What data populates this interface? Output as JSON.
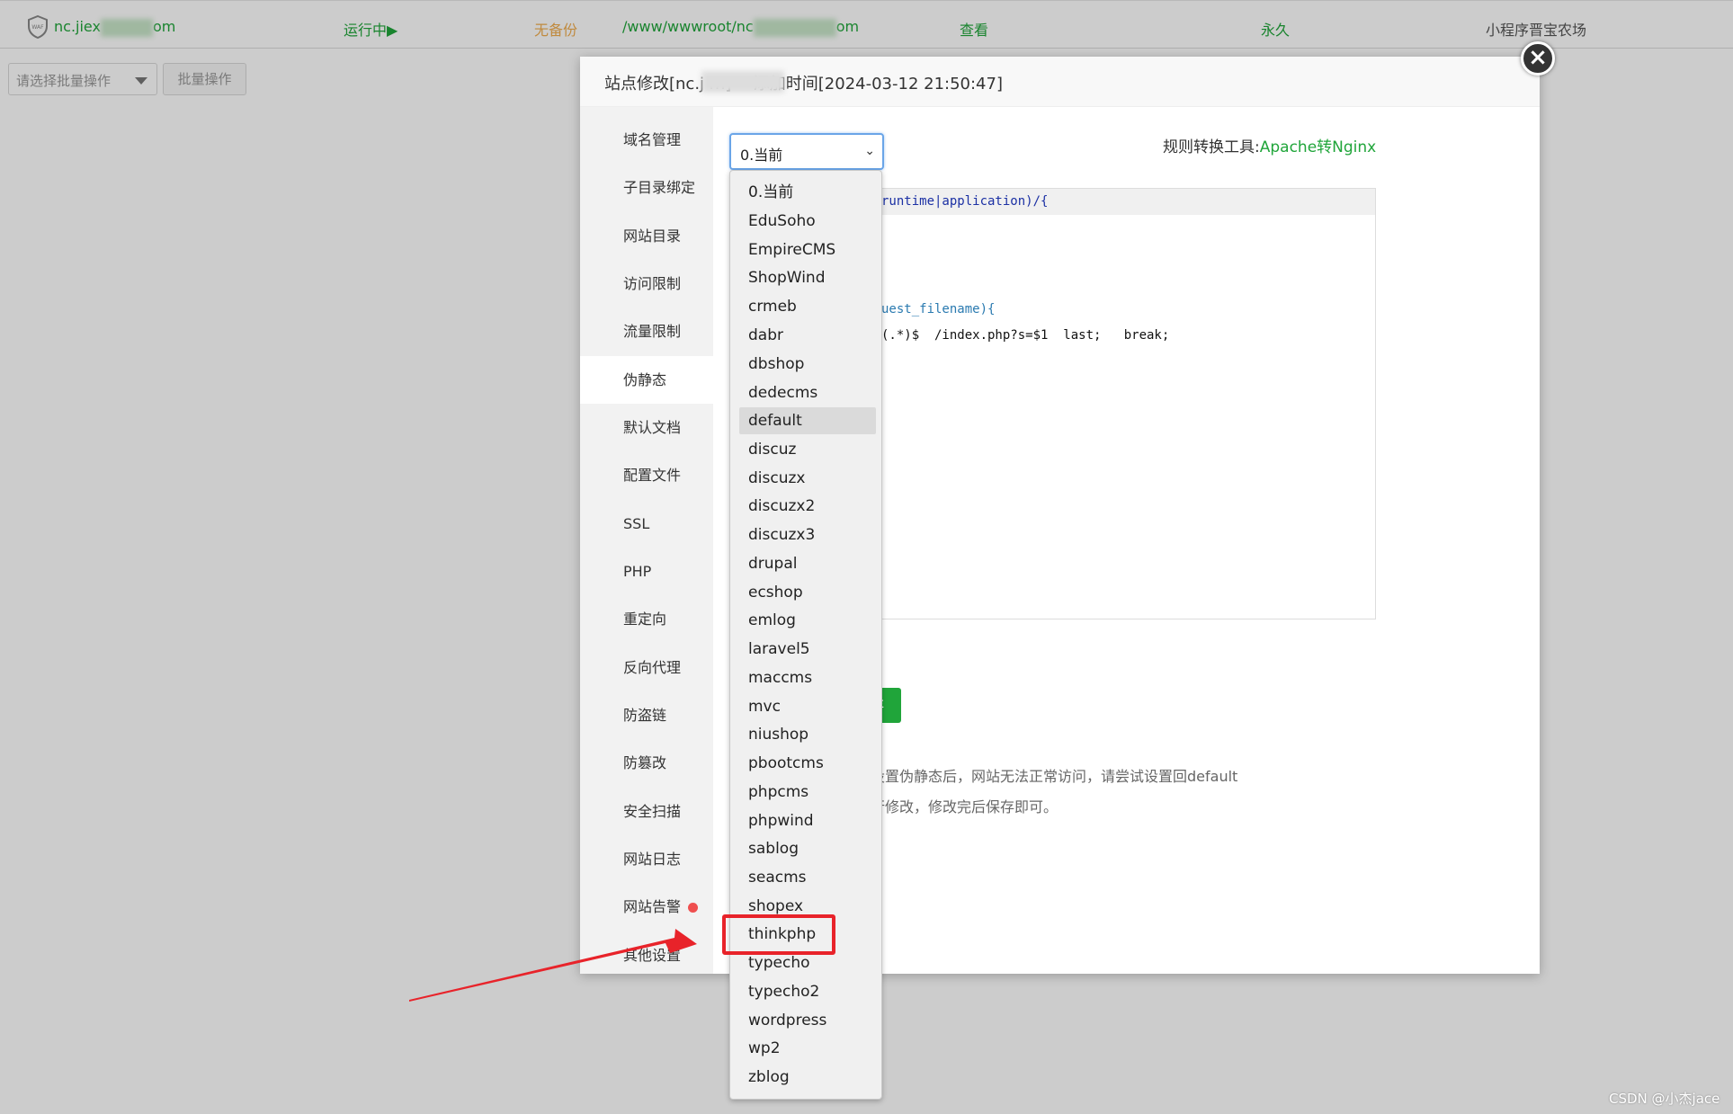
{
  "background_row": {
    "domain": "nc.jiex",
    "domain_suffix": "om",
    "status": "运行中▶",
    "backup": "无备份",
    "path": "/www/wwwroot/nc",
    "path_suffix": "om",
    "view": "查看",
    "expiry": "永久",
    "remark": "小程序晋宝农场"
  },
  "toolbar": {
    "batch_select_placeholder": "请选择批量操作",
    "batch_button": "批量操作"
  },
  "modal": {
    "title": "站点修改[nc.j              m] -- 添加时间[2024-03-12 21:50:47]",
    "close_label": "×",
    "nav": [
      {
        "label": "域名管理"
      },
      {
        "label": "子目录绑定"
      },
      {
        "label": "网站目录"
      },
      {
        "label": "访问限制"
      },
      {
        "label": "流量限制"
      },
      {
        "label": "伪静态"
      },
      {
        "label": "默认文档"
      },
      {
        "label": "配置文件"
      },
      {
        "label": "SSL"
      },
      {
        "label": "PHP"
      },
      {
        "label": "重定向"
      },
      {
        "label": "反向代理"
      },
      {
        "label": "防盗链"
      },
      {
        "label": "防篡改"
      },
      {
        "label": "安全扫描"
      },
      {
        "label": "网站日志"
      },
      {
        "label": "网站告警"
      },
      {
        "label": "其他设置"
      }
    ],
    "active_nav": "伪静态",
    "rule_select_value": "0.当前",
    "tool_label": "规则转换工具:",
    "tool_link": "Apache转Nginx",
    "code_lines": {
      "l1_pre": "",
      "l1_kw": "runtime|application)/{",
      "l2": "uest_filename){",
      "l3": "(.*)$  /index.php?s=$1  last;   break;"
    },
    "save_button": "存",
    "tips": [
      "设置伪静态后，网站无法正常访问，请尝试设置回default",
      "行修改，修改完后保存即可。"
    ]
  },
  "dropdown": {
    "options": [
      "0.当前",
      "EduSoho",
      "EmpireCMS",
      "ShopWind",
      "crmeb",
      "dabr",
      "dbshop",
      "dedecms",
      "default",
      "discuz",
      "discuzx",
      "discuzx2",
      "discuzx3",
      "drupal",
      "ecshop",
      "emlog",
      "laravel5",
      "maccms",
      "mvc",
      "niushop",
      "pbootcms",
      "phpcms",
      "phpwind",
      "sablog",
      "seacms",
      "shopex",
      "thinkphp",
      "typecho",
      "typecho2",
      "wordpress",
      "wp2",
      "zblog"
    ],
    "hovered": "default",
    "highlighted": "thinkphp"
  },
  "colors": {
    "accent_green": "#20a53a",
    "highlight_red": "#e8232a",
    "select_border": "#6aa5e8"
  },
  "watermark": "CSDN @小杰jace"
}
